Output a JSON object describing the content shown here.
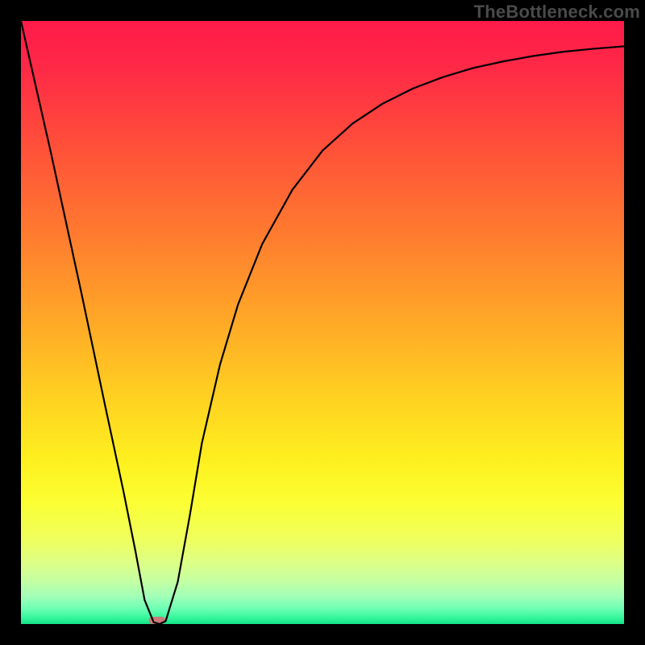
{
  "watermark": "TheBottleneck.com",
  "chart_data": {
    "type": "line",
    "title": "",
    "xlabel": "",
    "ylabel": "",
    "xlim": [
      0,
      100
    ],
    "ylim": [
      0,
      100
    ],
    "grid": false,
    "legend": false,
    "gradient_stops": [
      {
        "offset": 0.0,
        "color": "#ff1a4a"
      },
      {
        "offset": 0.08,
        "color": "#ff2a46"
      },
      {
        "offset": 0.2,
        "color": "#ff4d3a"
      },
      {
        "offset": 0.35,
        "color": "#ff7a2f"
      },
      {
        "offset": 0.5,
        "color": "#ffa927"
      },
      {
        "offset": 0.63,
        "color": "#ffd321"
      },
      {
        "offset": 0.73,
        "color": "#fef01f"
      },
      {
        "offset": 0.8,
        "color": "#fbff33"
      },
      {
        "offset": 0.86,
        "color": "#efff5e"
      },
      {
        "offset": 0.9,
        "color": "#dcff88"
      },
      {
        "offset": 0.93,
        "color": "#c3ffa4"
      },
      {
        "offset": 0.955,
        "color": "#a0ffb8"
      },
      {
        "offset": 0.975,
        "color": "#6cffb4"
      },
      {
        "offset": 0.99,
        "color": "#34f59a"
      },
      {
        "offset": 1.0,
        "color": "#14e386"
      }
    ],
    "series": [
      {
        "name": "bottleneck-curve",
        "x": [
          0,
          5,
          10,
          14,
          17,
          19,
          20.5,
          22,
          23,
          24,
          26,
          28,
          30,
          33,
          36,
          40,
          45,
          50,
          55,
          60,
          65,
          70,
          75,
          80,
          85,
          90,
          95,
          100
        ],
        "y": [
          100,
          78,
          55,
          36,
          22,
          12,
          4,
          0.3,
          0,
          0.5,
          7,
          18,
          30,
          43,
          53,
          63,
          72,
          78.5,
          83,
          86.3,
          88.8,
          90.7,
          92.2,
          93.3,
          94.2,
          94.9,
          95.4,
          95.8
        ]
      }
    ],
    "marker": {
      "name": "min-marker",
      "x": 22.6,
      "y": 0,
      "w": 2.8,
      "h": 1.2,
      "color": "#cc7a78"
    }
  }
}
